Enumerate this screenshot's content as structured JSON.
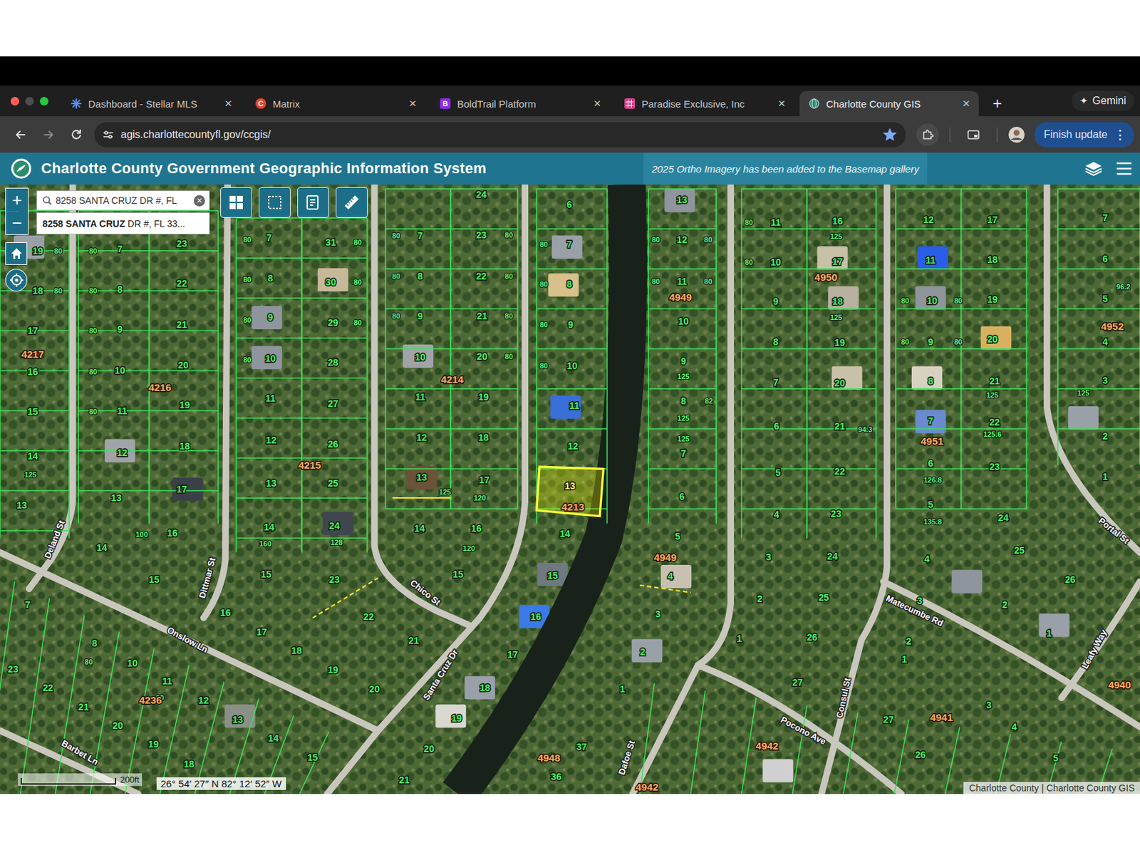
{
  "tabs": [
    {
      "label": "Dashboard - Stellar MLS",
      "kind": "stellar",
      "badge": "",
      "selected": false
    },
    {
      "label": "Matrix",
      "kind": "matrix",
      "badge": "C",
      "selected": false
    },
    {
      "label": "BoldTrail Platform",
      "kind": "boldtrail",
      "badge": "B",
      "selected": false
    },
    {
      "label": "Paradise Exclusive, Inc",
      "kind": "paradise",
      "badge": "",
      "selected": false
    },
    {
      "label": "Charlotte County GIS",
      "kind": "gis",
      "badge": "",
      "selected": true
    }
  ],
  "tab_close": "×",
  "new_tab": "+",
  "gemini": {
    "glyph": "✦",
    "label": "Gemini"
  },
  "address_bar": {
    "url": "agis.charlottecountyfl.gov/ccgis/",
    "bookmarked": true
  },
  "update_button": {
    "label": "Finish update",
    "glyph": "⋮"
  },
  "app_header": {
    "title": "Charlotte County Government Geographic Information System",
    "notice": "2025 Ortho Imagery has been added to the Basemap gallery"
  },
  "search": {
    "value": "8258 SANTA CRUZ DR #, FL",
    "clear": "×",
    "suggestion": {
      "match": "8258 SANTA CRUZ",
      "rest": " DR #, FL 33..."
    }
  },
  "zoom": {
    "in": "+",
    "out": "−"
  },
  "map": {
    "streets": [
      "Deland St",
      "Dittmar St",
      "Onslow Ln",
      "Chico St",
      "Santa Cruz Dr",
      "Barbet Ln",
      "Dafoe St",
      "Pocono Ave",
      "Consul St",
      "Matecumbe Rd",
      "Leafy Way",
      "Portal St"
    ],
    "blocks": [
      "4217",
      "4216",
      "4214",
      "4215",
      "4949",
      "4950",
      "4951",
      "4952",
      "4949",
      "4236",
      "4948",
      "4942",
      "4942",
      "4941",
      "4940"
    ],
    "lots": [
      "19",
      "18",
      "17",
      "16",
      "15",
      "14",
      "13",
      "7",
      "8",
      "9",
      "10",
      "11",
      "12",
      "13",
      "14",
      "15",
      "23",
      "22",
      "21",
      "20",
      "19",
      "18",
      "17",
      "16",
      "7",
      "8",
      "9",
      "10",
      "11",
      "12",
      "13",
      "14",
      "15",
      "31",
      "30",
      "29",
      "28",
      "27",
      "26",
      "25",
      "24",
      "23",
      "7",
      "8",
      "9",
      "10",
      "11",
      "12",
      "13",
      "14",
      "24",
      "23",
      "22",
      "21",
      "20",
      "19",
      "18",
      "17",
      "16",
      "15",
      "6",
      "7",
      "8",
      "9",
      "10",
      "11",
      "12",
      "14",
      "15",
      "16",
      "17",
      "18",
      "19",
      "20",
      "21",
      "13",
      "12",
      "11",
      "10",
      "9",
      "8",
      "7",
      "6",
      "5",
      "4",
      "3",
      "2",
      "1",
      "11",
      "10",
      "9",
      "8",
      "7",
      "6",
      "5",
      "4",
      "3",
      "2",
      "1",
      "16",
      "17",
      "18",
      "19",
      "20",
      "21",
      "22",
      "23",
      "24",
      "25",
      "26",
      "27",
      "12",
      "11",
      "10",
      "9",
      "8",
      "7",
      "6",
      "5",
      "4",
      "3",
      "2",
      "17",
      "18",
      "19",
      "20",
      "21",
      "22",
      "23",
      "24",
      "25",
      "26",
      "7",
      "6",
      "5",
      "4",
      "3",
      "2",
      "1",
      "7",
      "8",
      "10",
      "11",
      "12",
      "13",
      "14",
      "15",
      "16",
      "17",
      "18",
      "19",
      "20",
      "21",
      "22",
      "23",
      "22",
      "21",
      "20",
      "19",
      "18",
      "37",
      "36",
      "1",
      "27",
      "26",
      "3",
      "4",
      "5",
      "2",
      "1"
    ],
    "dimensions": [
      "80",
      "80",
      "80",
      "80",
      "80",
      "80",
      "80",
      "125",
      "80",
      "80",
      "80",
      "80",
      "80",
      "80",
      "80",
      "80",
      "80",
      "80",
      "80",
      "80",
      "80",
      "80",
      "80",
      "80",
      "80",
      "80",
      "80",
      "80",
      "80",
      "80",
      "82",
      "125",
      "125",
      "125",
      "80",
      "80",
      "125",
      "125",
      "94.3",
      "80",
      "80",
      "80",
      "80",
      "125",
      "125.6",
      "126.8",
      "135.8",
      "125",
      "96.2",
      "128",
      "160",
      "125",
      "120",
      "120",
      "100",
      "80",
      "80"
    ],
    "highlighted_parcel": {
      "lot": "13",
      "block": "4213",
      "selected": true
    }
  },
  "scale": "200ft",
  "coordinates": "26° 54′ 27″ N 82° 12′ 52″ W",
  "attribution": "Charlotte County | Charlotte County GIS"
}
